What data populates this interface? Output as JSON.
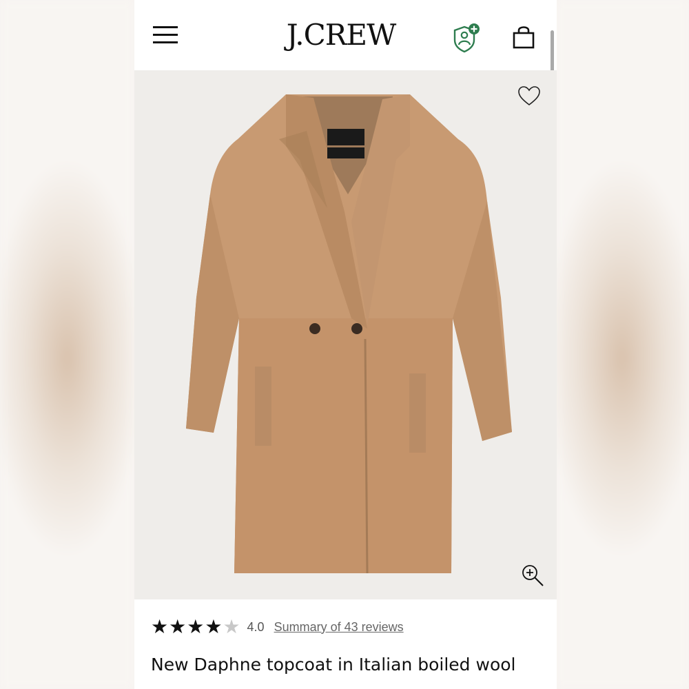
{
  "header": {
    "brand_logo": "J.CREW",
    "icons": {
      "menu": "hamburger-menu-icon",
      "rewards": "rewards-account-icon",
      "bag": "shopping-bag-icon"
    }
  },
  "product_image": {
    "icons": {
      "favorite": "heart-icon",
      "zoom": "zoom-in-icon"
    }
  },
  "reviews": {
    "rating": 4.0,
    "rating_text": "4.0",
    "stars_max": 5,
    "summary_link": "Summary of 43 reviews"
  },
  "product": {
    "title": "New Daphne topcoat in Italian boiled wool"
  },
  "colors": {
    "accent_green": "#2e7d4f",
    "coat_camel": "#c89a72",
    "text_primary": "#111111"
  }
}
